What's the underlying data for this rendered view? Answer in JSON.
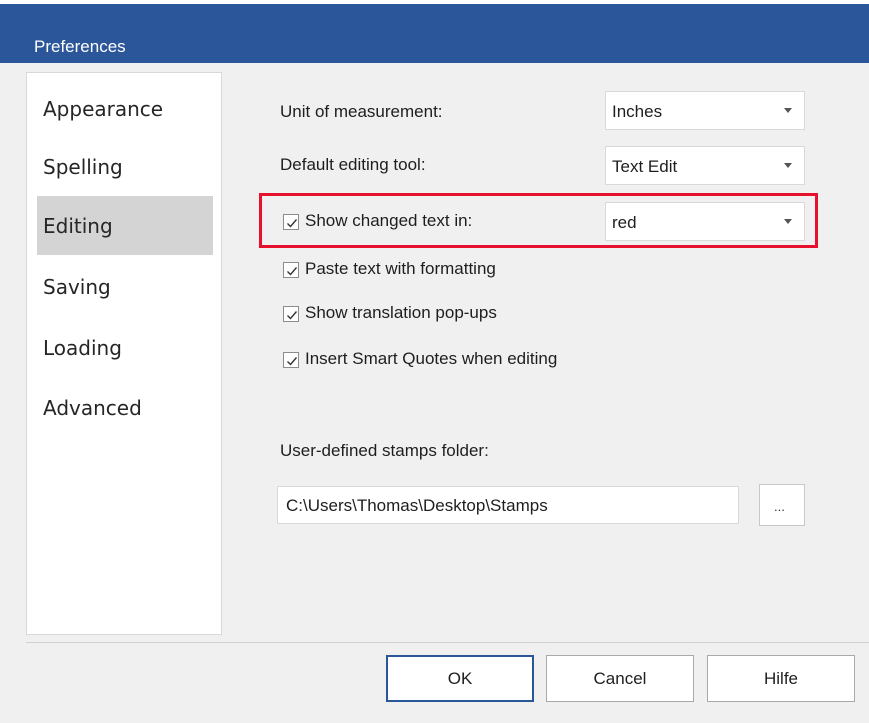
{
  "dialog": {
    "title": "Preferences"
  },
  "sidebar": {
    "items": [
      {
        "label": "Appearance"
      },
      {
        "label": "Spelling"
      },
      {
        "label": "Editing",
        "selected": true
      },
      {
        "label": "Saving"
      },
      {
        "label": "Loading"
      },
      {
        "label": "Advanced"
      }
    ]
  },
  "settings": {
    "unit": {
      "label": "Unit of measurement:",
      "value": "Inches"
    },
    "tool": {
      "label": "Default editing tool:",
      "value": "Text Edit"
    },
    "changed_text": {
      "label": "Show changed text in:",
      "value": "red",
      "checked": true
    },
    "paste": {
      "label": "Paste text with formatting",
      "checked": true
    },
    "translation": {
      "label": "Show translation pop-ups",
      "checked": true
    },
    "smart_quotes": {
      "label": "Insert Smart Quotes when editing",
      "checked": true
    },
    "stamps": {
      "label": "User-defined stamps folder:",
      "value": "C:\\Users\\Thomas\\Desktop\\Stamps",
      "browse_label": "..."
    }
  },
  "buttons": {
    "ok": "OK",
    "cancel": "Cancel",
    "help": "Hilfe"
  },
  "colors": {
    "titlebar": "#2b579a",
    "highlight": "#e8112d",
    "selected_nav": "#d4d4d4"
  }
}
